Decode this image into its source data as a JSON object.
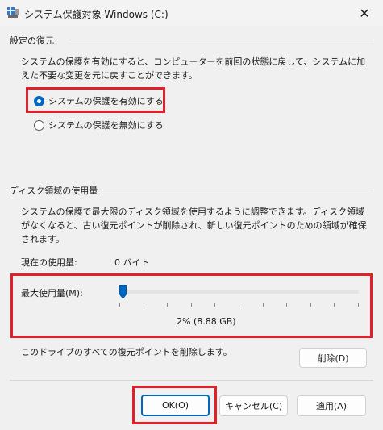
{
  "window": {
    "title": "システム保護対象 Windows (C:)",
    "close_glyph": "✕",
    "icon": "system-protection-icon"
  },
  "restore_settings": {
    "heading": "設定の復元",
    "description": "システムの保護を有効にすると、コンピューターを前回の状態に戻して、システムに加えた不要な変更を元に戻すことができます。",
    "options": [
      {
        "label": "システムの保護を有効にする",
        "selected": true
      },
      {
        "label": "システムの保護を無効にする",
        "selected": false
      }
    ]
  },
  "disk_usage": {
    "heading": "ディスク領域の使用量",
    "description": "システムの保護で最大限のディスク領域を使用するように調整できます。ディスク領域がなくなると、古い復元ポイントが削除され、新しい復元ポイントのための領域が確保されます。",
    "current_label": "現在の使用量:",
    "current_value": "0 バイト",
    "max_label": "最大使用量(M):",
    "max_percent": 2,
    "max_value_text": "2% (8.88 GB)",
    "delete_text": "このドライブのすべての復元ポイントを削除します。",
    "delete_button": "削除(D)"
  },
  "footer": {
    "ok": "OK(O)",
    "cancel": "キャンセル(C)",
    "apply": "適用(A)"
  },
  "colors": {
    "accent": "#0067c0",
    "highlight": "#e0202a"
  }
}
